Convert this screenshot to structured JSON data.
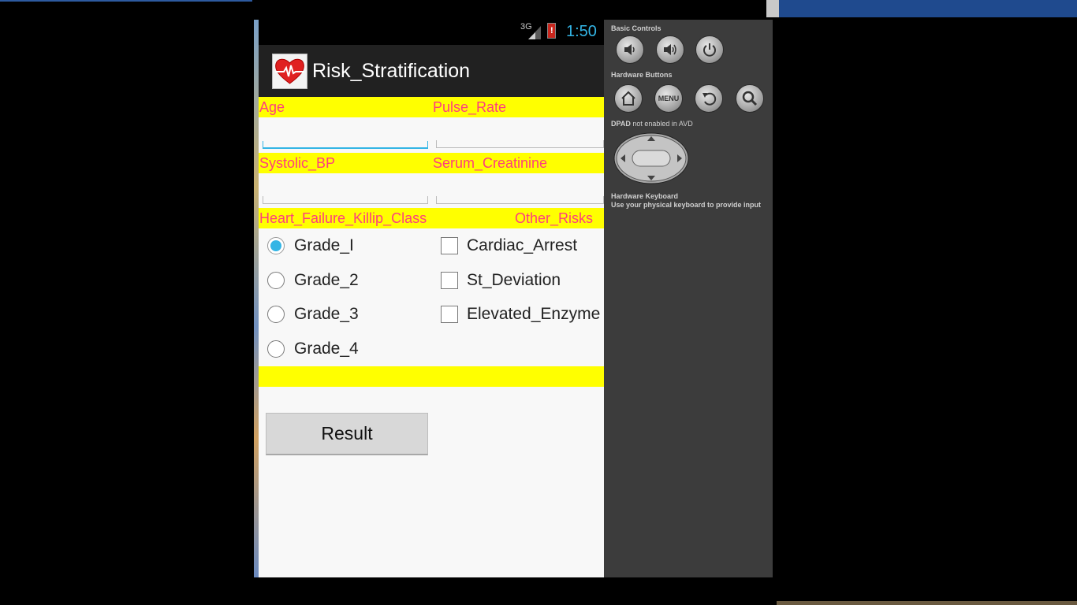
{
  "statusbar": {
    "network": "3G",
    "time": "1:50"
  },
  "app": {
    "title": "Risk_Stratification"
  },
  "form": {
    "age_label": "Age",
    "pulse_label": "Pulse_Rate",
    "systolic_label": "Systolic_BP",
    "creatinine_label": "Serum_Creatinine",
    "killip_label": "Heart_Failure_Killip_Class",
    "other_risks_label": "Other_Risks",
    "grades": [
      "Grade_I",
      "Grade_2",
      "Grade_3",
      "Grade_4"
    ],
    "selected_grade": "Grade_I",
    "risks": [
      "Cardiac_Arrest",
      "St_Deviation",
      "Elevated_Enzyme"
    ],
    "result_button": "Result"
  },
  "controls": {
    "basic_controls": "Basic Controls",
    "hardware_buttons": "Hardware Buttons",
    "dpad_bold": "DPAD",
    "dpad_rest": "not enabled in AVD",
    "keyboard_title": "Hardware Keyboard",
    "keyboard_hint": "Use your physical keyboard to provide input",
    "menu_label": "MENU"
  },
  "colors": {
    "accent": "#33b5e5",
    "label_pink": "#ff3d7f",
    "band_yellow": "#ffff00",
    "panel": "#3c3c3c"
  }
}
